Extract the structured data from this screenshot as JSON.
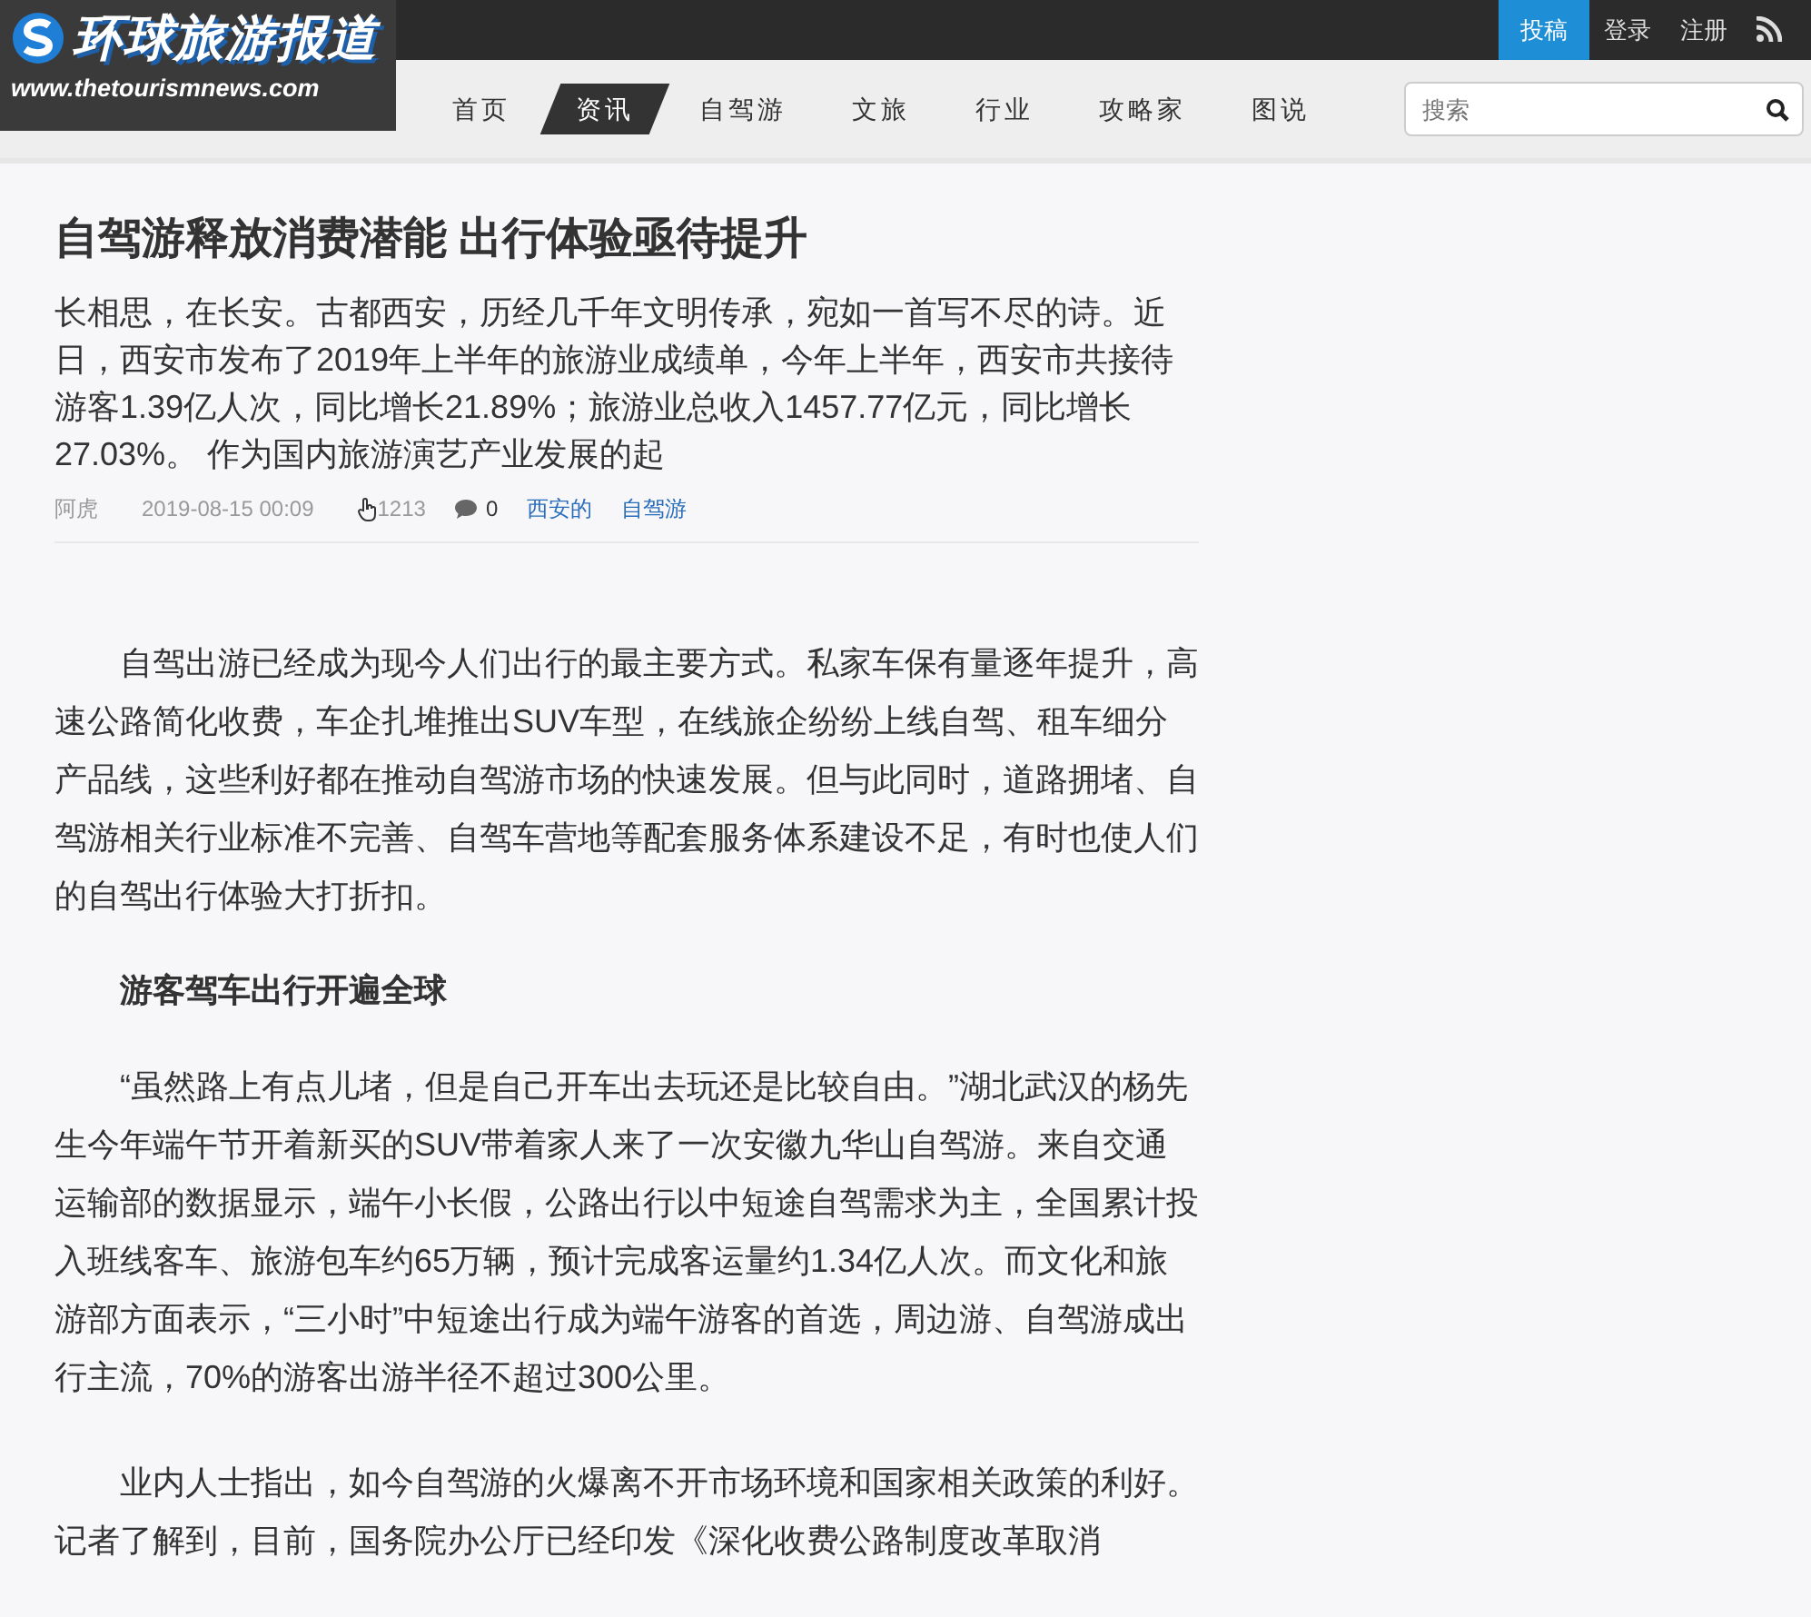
{
  "header": {
    "logo": {
      "title": "环球旅游报道",
      "url": "www.thetourismnews.com"
    },
    "top_links": [
      {
        "label": "投稿",
        "selected": true
      },
      {
        "label": "登录",
        "selected": false
      },
      {
        "label": "注册",
        "selected": false
      }
    ],
    "nav": [
      {
        "label": "首页",
        "selected": false
      },
      {
        "label": "资讯",
        "selected": true
      },
      {
        "label": "自驾游",
        "selected": false
      },
      {
        "label": "文旅",
        "selected": false
      },
      {
        "label": "行业",
        "selected": false
      },
      {
        "label": "攻略家",
        "selected": false
      },
      {
        "label": "图说",
        "selected": false
      }
    ],
    "search": {
      "placeholder": "搜索"
    }
  },
  "article": {
    "title": "自驾游释放消费潜能 出行体验亟待提升",
    "summary": "长相思，在长安。古都西安，历经几千年文明传承，宛如一首写不尽的诗。近日，西安市发布了2019年上半年的旅游业成绩单，今年上半年，西安市共接待游客1.39亿人次，同比增长21.89%；旅游业总收入1457.77亿元，同比增长27.03%。 作为国内旅游演艺产业发展的起",
    "meta": {
      "author": "阿虎",
      "date": "2019-08-15 00:09",
      "views": "1213",
      "comments": "0",
      "tags": [
        "西安的",
        "自驾游"
      ]
    },
    "body": [
      {
        "kind": "paragraph",
        "text": "自驾出游已经成为现今人们出行的最主要方式。私家车保有量逐年提升，高速公路简化收费，车企扎堆推出SUV车型，在线旅企纷纷上线自驾、租车细分产品线，这些利好都在推动自驾游市场的快速发展。但与此同时，道路拥堵、自驾游相关行业标准不完善、自驾车营地等配套服务体系建设不足，有时也使人们的自驾出行体验大打折扣。"
      },
      {
        "kind": "heading",
        "text": "游客驾车出行开遍全球"
      },
      {
        "kind": "paragraph",
        "text": "“虽然路上有点儿堵，但是自己开车出去玩还是比较自由。”湖北武汉的杨先生今年端午节开着新买的SUV带着家人来了一次安徽九华山自驾游。来自交通运输部的数据显示，端午小长假，公路出行以中短途自驾需求为主，全国累计投入班线客车、旅游包车约65万辆，预计完成客运量约1.34亿人次。而文化和旅游部方面表示，“三小时”中短途出行成为端午游客的首选，周边游、自驾游成出行主流，70%的游客出游半径不超过300公里。"
      },
      {
        "kind": "paragraph",
        "text": "业内人士指出，如今自驾游的火爆离不开市场环境和国家相关政策的利好。记者了解到，目前，国务院办公厅已经印发《深化收费公路制度改革取消"
      }
    ]
  }
}
